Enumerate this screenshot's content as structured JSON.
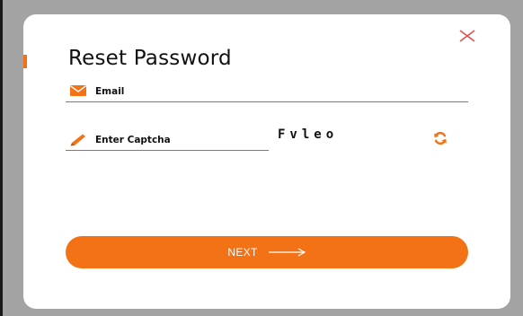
{
  "modal": {
    "title": "Reset Password",
    "close_icon": "close-icon"
  },
  "email": {
    "icon": "envelope-icon",
    "placeholder": "Email",
    "value": ""
  },
  "captcha": {
    "icon": "pencil-icon",
    "placeholder": "Enter Captcha",
    "value": "",
    "code": "Fvleo",
    "refresh_icon": "refresh-icon"
  },
  "next_button": {
    "label": "NEXT",
    "icon": "arrow-right-icon"
  },
  "colors": {
    "accent": "#f47216",
    "underline": "#d9534f",
    "overlay": "#a3a3a3"
  }
}
